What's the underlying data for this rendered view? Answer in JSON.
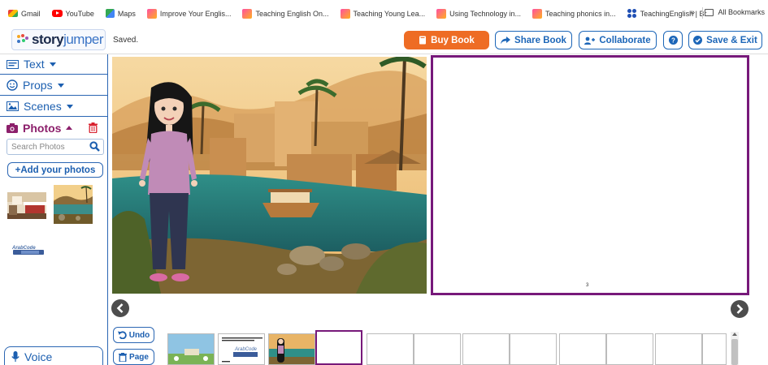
{
  "bookmarks": {
    "items": [
      {
        "label": "Gmail",
        "icon": "gmail-icon"
      },
      {
        "label": "YouTube",
        "icon": "youtube-icon"
      },
      {
        "label": "Maps",
        "icon": "maps-icon"
      },
      {
        "label": "Improve Your Englis...",
        "icon": "pen-icon"
      },
      {
        "label": "Teaching English On...",
        "icon": "pen-icon"
      },
      {
        "label": "Teaching Young Lea...",
        "icon": "pen-icon"
      },
      {
        "label": "Using Technology in...",
        "icon": "pen-icon"
      },
      {
        "label": "Teaching phonics in...",
        "icon": "pen-icon"
      },
      {
        "label": "TeachingEnglish | Br...",
        "icon": "teachingenglish-icon"
      }
    ],
    "more": "»",
    "all_bookmarks": "All Bookmarks"
  },
  "header": {
    "logo_story": "story",
    "logo_jumper": "jumper",
    "status": "Saved.",
    "buy_book": "Buy Book",
    "share_book": "Share Book",
    "collaborate": "Collaborate",
    "save_exit": "Save & Exit"
  },
  "sidebar": {
    "items": [
      {
        "label": "Text",
        "icon": "text-icon"
      },
      {
        "label": "Props",
        "icon": "smiley-icon"
      },
      {
        "label": "Scenes",
        "icon": "image-icon"
      },
      {
        "label": "Photos",
        "icon": "camera-icon"
      }
    ],
    "search_placeholder": "Search Photos",
    "add_photos": "+Add your photos",
    "voice": "Voice"
  },
  "pages": {
    "right_page_number": "3"
  },
  "bottom": {
    "undo": "Undo",
    "page": "Page"
  },
  "colors": {
    "accent_blue": "#1c66b8",
    "buy_orange": "#ee6c24",
    "selected_purple": "#77197a"
  }
}
